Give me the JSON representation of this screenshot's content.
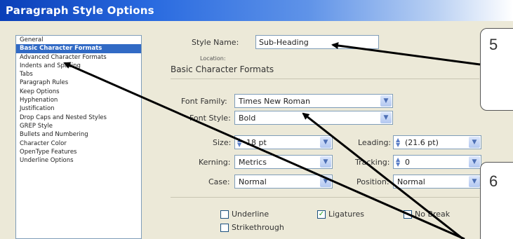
{
  "window": {
    "title": "Paragraph Style Options"
  },
  "sidebar": {
    "items": [
      {
        "label": "General",
        "selected": false
      },
      {
        "label": "Basic Character Formats",
        "selected": true
      },
      {
        "label": "Advanced Character Formats",
        "selected": false
      },
      {
        "label": "Indents and Spacing",
        "selected": false
      },
      {
        "label": "Tabs",
        "selected": false
      },
      {
        "label": "Paragraph Rules",
        "selected": false
      },
      {
        "label": "Keep Options",
        "selected": false
      },
      {
        "label": "Hyphenation",
        "selected": false
      },
      {
        "label": "Justification",
        "selected": false
      },
      {
        "label": "Drop Caps and Nested Styles",
        "selected": false
      },
      {
        "label": "GREP Style",
        "selected": false
      },
      {
        "label": "Bullets and Numbering",
        "selected": false
      },
      {
        "label": "Character Color",
        "selected": false
      },
      {
        "label": "OpenType Features",
        "selected": false
      },
      {
        "label": "Underline Options",
        "selected": false
      }
    ]
  },
  "form": {
    "style_name_label": "Style Name:",
    "style_name_value": "Sub-Heading",
    "location_label": "Location:",
    "section_title": "Basic Character Formats",
    "font_family_label": "Font Family:",
    "font_family_value": "Times New Roman",
    "font_style_label": "Font Style:",
    "font_style_value": "Bold",
    "size_label": "Size:",
    "size_value": "18 pt",
    "leading_label": "Leading:",
    "leading_value": "(21.6 pt)",
    "kerning_label": "Kerning:",
    "kerning_value": "Metrics",
    "tracking_label": "Tracking:",
    "tracking_value": "0",
    "case_label": "Case:",
    "case_value": "Normal",
    "position_label": "Position:",
    "position_value": "Normal",
    "underline_label": "Underline",
    "ligatures_label": "Ligatures",
    "no_break_label": "No Break",
    "strikethrough_label": "Strikethrough",
    "ligatures_checked": true,
    "underline_checked": false,
    "strikethrough_checked": false,
    "no_break_checked": false
  },
  "callouts": {
    "step_5": "5",
    "step_6": "6"
  },
  "colors": {
    "title_bar": "#0a3fb8",
    "dialog_bg": "#ece9d8",
    "selection": "#316ac5",
    "field_border": "#7f9db9"
  }
}
